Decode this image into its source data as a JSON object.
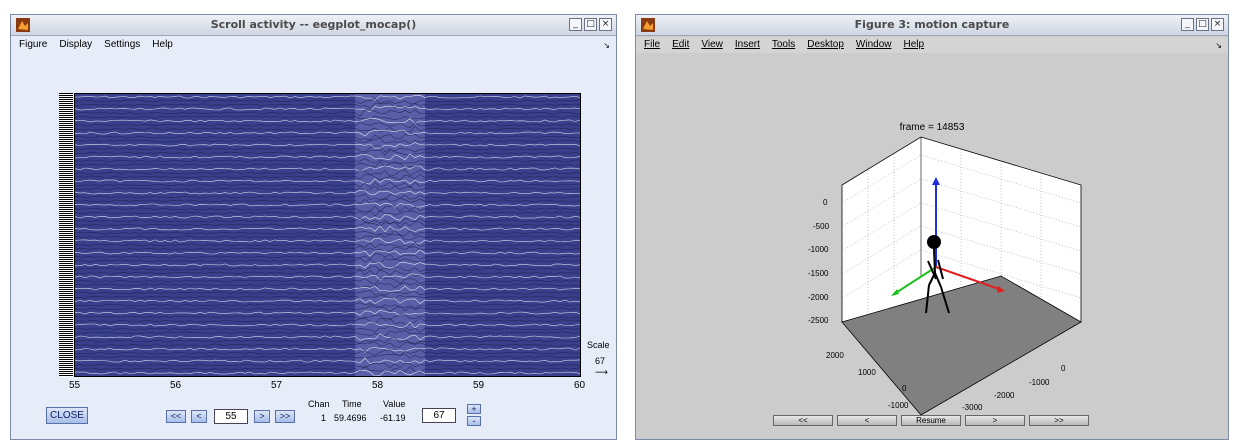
{
  "left_window": {
    "title": "Scroll activity -- eegplot_mocap()",
    "menu": [
      "Figure",
      "Display",
      "Settings",
      "Help"
    ],
    "x_ticks": [
      "55",
      "56",
      "57",
      "58",
      "59",
      "60"
    ],
    "scale_label": "Scale",
    "scale_value": "67",
    "close_label": "CLOSE",
    "nav": {
      "first": "<<",
      "prev": "<",
      "position": "55",
      "next": ">",
      "last": ">>"
    },
    "info": {
      "chan_header": "Chan",
      "time_header": "Time",
      "value_header": "Value",
      "chan": "1",
      "time": "59.4696",
      "value": "-61.19"
    },
    "scale_input": "67",
    "plus": "+",
    "minus": "-"
  },
  "right_window": {
    "title": "Figure 3: motion capture",
    "menu": [
      "File",
      "Edit",
      "View",
      "Insert",
      "Tools",
      "Desktop",
      "Window",
      "Help"
    ],
    "frame_label": "frame = 14853",
    "z_ticks": [
      "0",
      "-500",
      "-1000",
      "-1500",
      "-2000",
      "-2500"
    ],
    "y_ticks": [
      "2000",
      "1000",
      "0",
      "-1000"
    ],
    "x_ticks": [
      "0",
      "-1000",
      "-2000",
      "-3000"
    ],
    "buttons": [
      "<<",
      "<",
      "Resume",
      ">",
      ">>"
    ]
  },
  "colors": {
    "eeg_background": "#3a3f8c",
    "axis_red": "#e02020",
    "axis_green": "#20c020",
    "axis_blue": "#2030e0",
    "floor": "#808080"
  }
}
